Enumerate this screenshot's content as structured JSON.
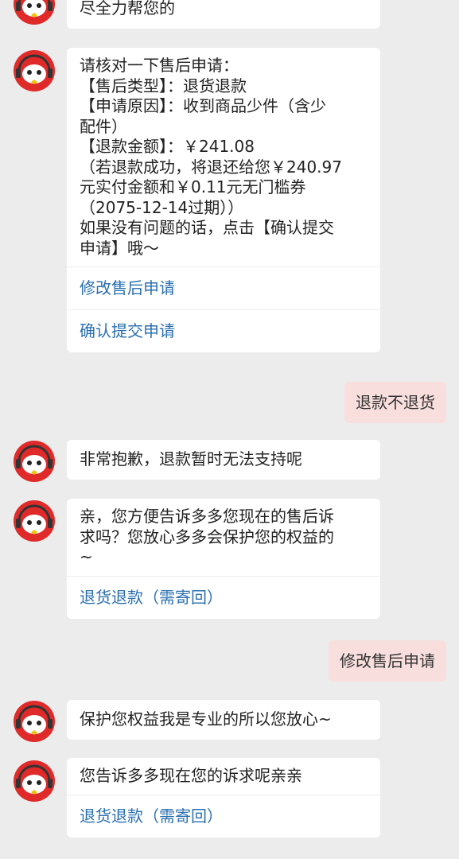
{
  "messages": [
    {
      "text": "尽全力帮您的"
    },
    {
      "text": "请核对一下售后申请：\n【售后类型】：退货退款\n【申请原因】：收到商品少件（含少\n配件）\n【退款金额】：￥241.08\n（若退款成功，将退还给您￥240.97\n元实付金额和￥0.11元无门槛券\n（2075-12-14过期））\n如果没有问题的话，点击【确认提交\n申请】哦～",
      "actions": [
        "修改售后申请",
        "确认提交申请"
      ]
    },
    {
      "user": "退款不退货"
    },
    {
      "text": "非常抱歉，退款暂时无法支持呢"
    },
    {
      "text": "亲，您方便告诉多多您现在的售后诉\n求吗？您放心多多会保护您的权益的\n~",
      "actions": [
        "退货退款（需寄回）"
      ]
    },
    {
      "user": "修改售后申请"
    },
    {
      "text": "保护您权益我是专业的所以您放心~"
    },
    {
      "text": "您告诉多多现在您的诉求呢亲亲",
      "actions": [
        "退货退款（需寄回）"
      ]
    }
  ],
  "colors": {
    "background": "#ececec",
    "user_bubble": "#f8dfdd",
    "link": "#2a6fb0",
    "avatar_red": "#e02a2a"
  }
}
